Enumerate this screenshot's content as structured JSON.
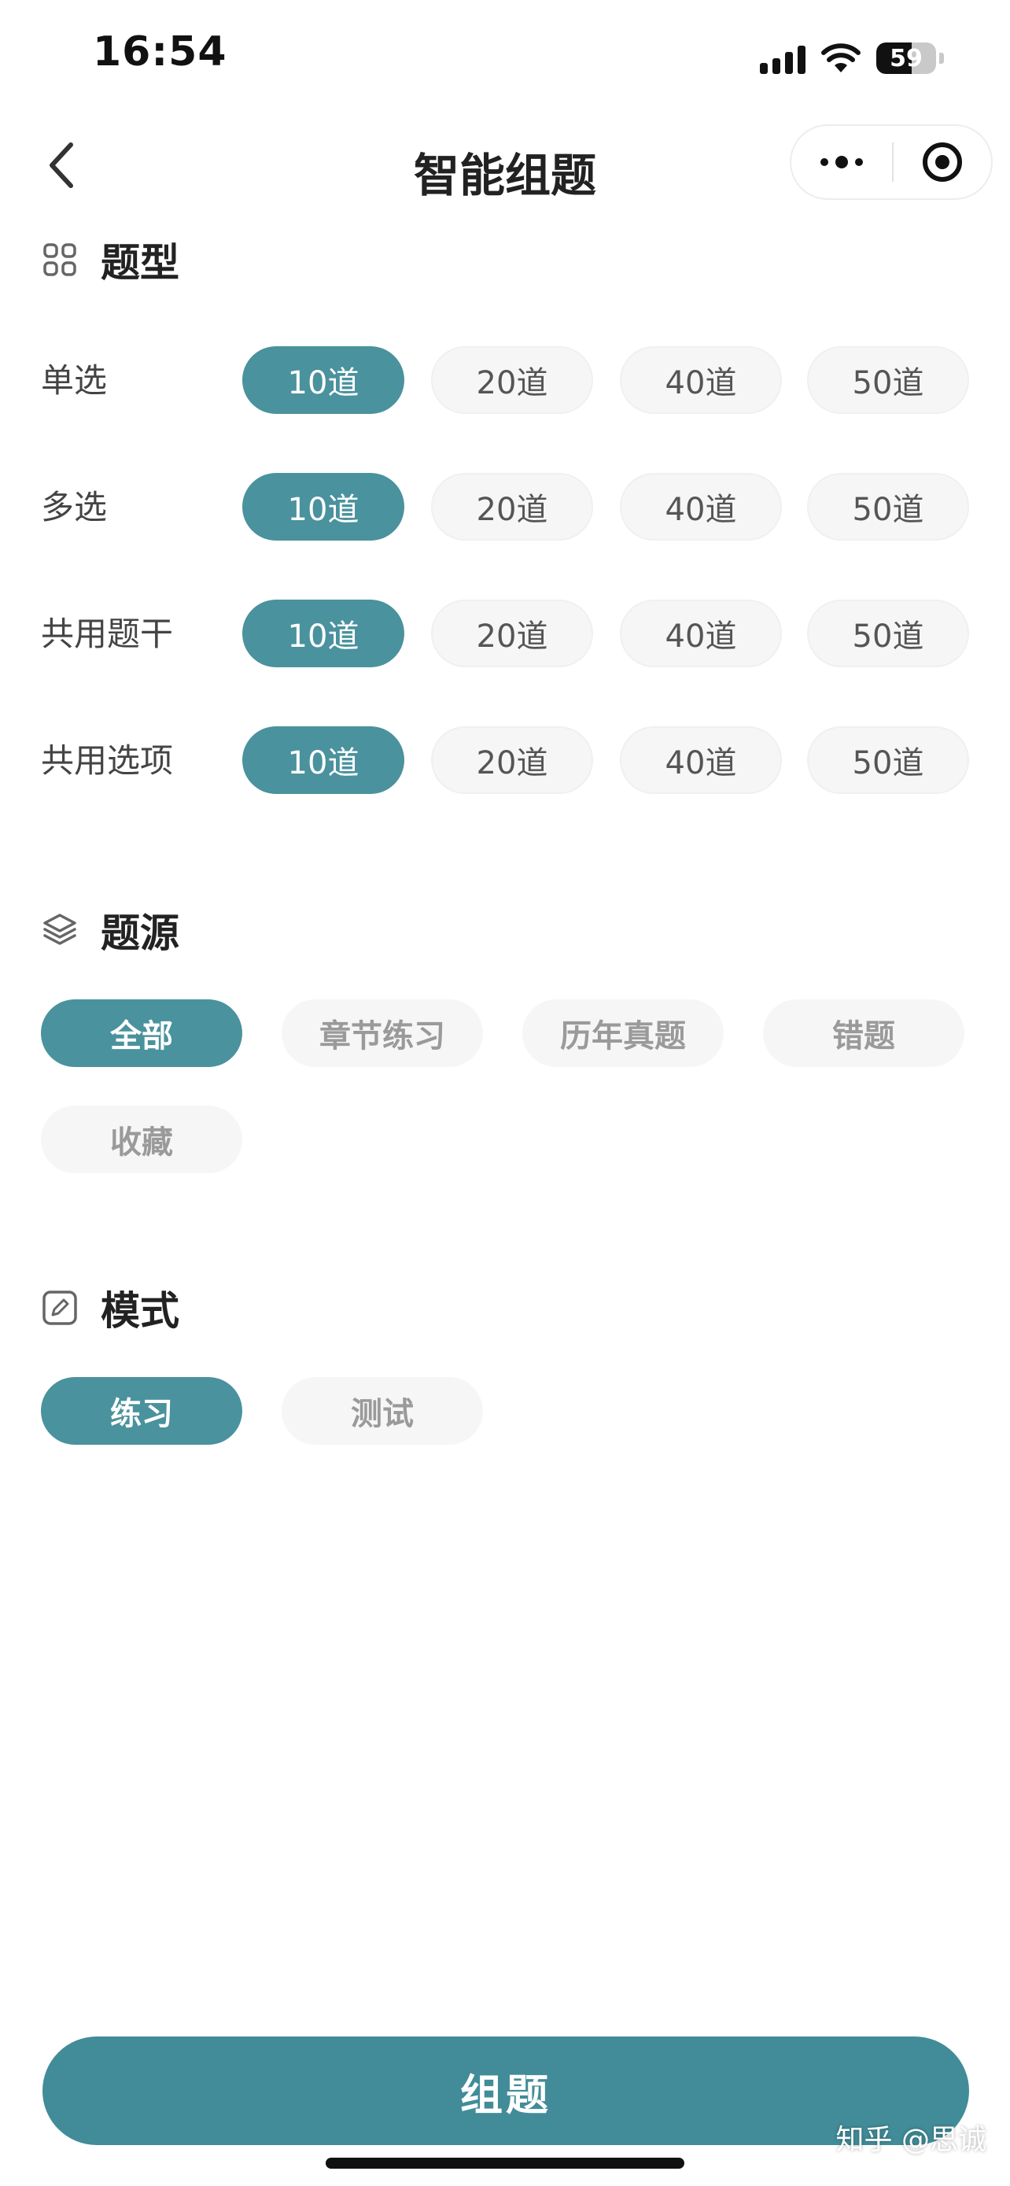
{
  "status_bar": {
    "time": "16:54",
    "battery": "59",
    "battery_level": 59
  },
  "nav": {
    "title": "智能组题"
  },
  "question_types": {
    "title": "题型",
    "rows": [
      {
        "label": "单选",
        "options": [
          "10道",
          "20道",
          "40道",
          "50道"
        ],
        "selected_index": 0
      },
      {
        "label": "多选",
        "options": [
          "10道",
          "20道",
          "40道",
          "50道"
        ],
        "selected_index": 0
      },
      {
        "label": "共用题干",
        "options": [
          "10道",
          "20道",
          "40道",
          "50道"
        ],
        "selected_index": 0
      },
      {
        "label": "共用选项",
        "options": [
          "10道",
          "20道",
          "40道",
          "50道"
        ],
        "selected_index": 0
      }
    ]
  },
  "source": {
    "title": "题源",
    "options": [
      "全部",
      "章节练习",
      "历年真题",
      "错题",
      "收藏"
    ],
    "selected_index": 0
  },
  "mode": {
    "title": "模式",
    "options": [
      "练习",
      "测试"
    ],
    "selected_index": 0
  },
  "submit": {
    "label": "组题"
  },
  "watermark": "知乎 @思诚",
  "colors": {
    "accent": "#4a929d",
    "button": "#418c98",
    "chip_off_bg": "#f6f6f6"
  },
  "icons": {
    "question_types": "grid-icon",
    "source": "layers-icon",
    "mode": "edit-icon"
  }
}
